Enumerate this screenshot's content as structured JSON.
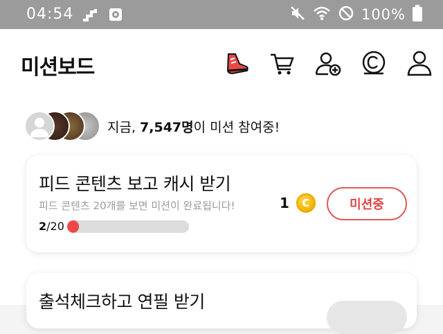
{
  "status_bar": {
    "time": "04:54",
    "battery_text": "100%"
  },
  "header": {
    "title": "미션보드",
    "icons": [
      "sneaker-icon",
      "cart-icon",
      "add-friend-icon",
      "coin-c-icon",
      "user-icon"
    ]
  },
  "participants": {
    "prefix": "지금, ",
    "count": "7,547명",
    "suffix": "이 미션 참여중!"
  },
  "missions": [
    {
      "title": "피드 콘텐츠 보고 캐시 받기",
      "subtitle": "피드 콘텐츠 20개를 보면 미션이 완료됩니다!",
      "progress_current": "2",
      "progress_total": "/20",
      "progress_fraction": 0.1,
      "reward": "1",
      "coin_symbol": "C",
      "button_label": "미션중"
    },
    {
      "title": "출석체크하고 연필 받기"
    }
  ],
  "colors": {
    "accent": "#e0433f",
    "coin": "#f2b300",
    "status_bar": "#9b9b9b"
  }
}
